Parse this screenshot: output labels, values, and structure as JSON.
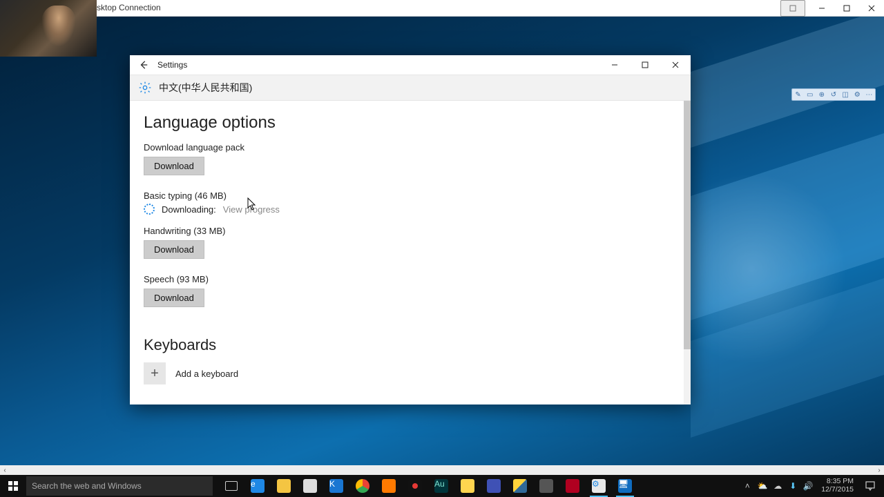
{
  "rdc": {
    "title_suffix": "sktop Connection"
  },
  "settings": {
    "window_title": "Settings",
    "language_display": "中文(中华人民共和国)",
    "sections": {
      "language_options_heading": "Language options",
      "download_lang_pack_label": "Download language pack",
      "download_btn": "Download",
      "basic_typing_label": "Basic typing (46 MB)",
      "downloading_label": "Downloading:",
      "view_progress": "View progress",
      "handwriting_label": "Handwriting (33 MB)",
      "speech_label": "Speech (93 MB)",
      "keyboards_heading": "Keyboards",
      "add_keyboard": "Add a keyboard"
    }
  },
  "taskbar": {
    "search_placeholder": "Search the web and Windows",
    "time": "8:35 PM",
    "date": "12/7/2015"
  }
}
